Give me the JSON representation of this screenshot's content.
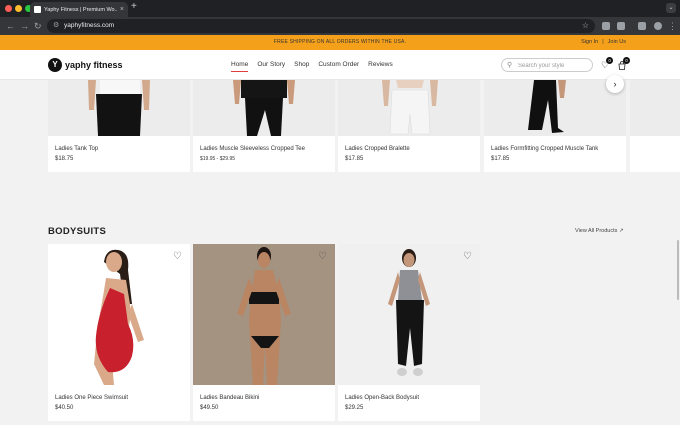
{
  "browser": {
    "tab_title": "Yaphy Fitness | Premium Wo...",
    "url": "yaphyfitness.com",
    "new_tab": "+",
    "tab_close": "×"
  },
  "promo": {
    "text": "FREE SHIPPING ON ALL ORDERS WITHIN THE USA.",
    "sign_in": "Sign In",
    "separator": "|",
    "join": "Join Us"
  },
  "header": {
    "logo_mark": "Y",
    "logo_text": "yaphy fitness",
    "nav": [
      "Home",
      "Our Story",
      "Shop",
      "Custom Order",
      "Reviews"
    ],
    "search_placeholder": "Search your style",
    "wishlist_count": "0",
    "cart_count": "0"
  },
  "top_row": [
    {
      "name": "Ladies Tank Top",
      "price": "$18.75"
    },
    {
      "name": "Ladies Muscle Sleeveless Cropped Tee",
      "price": "$19.95 - $29.95"
    },
    {
      "name": "Ladies Cropped Bralette",
      "price": "$17.85"
    },
    {
      "name": "Ladies Formfitting Cropped Muscle Tank",
      "price": "$17.85"
    }
  ],
  "bodysuits": {
    "title": "BODYSUITS",
    "view_all": "View All Products",
    "products": [
      {
        "name": "Ladies One Piece Swimsuit",
        "price": "$40.50"
      },
      {
        "name": "Ladies Bandeau Bikini",
        "price": "$49.50"
      },
      {
        "name": "Ladies Open-Back Bodysuit",
        "price": "$29.25"
      }
    ]
  },
  "colors": {
    "promo_bar": "#f5a01a",
    "active_nav_underline": "#e23b3b",
    "browser_dark": "#202124"
  },
  "icons": [
    "search-icon",
    "heart-icon",
    "cart-icon",
    "chevron-right-icon",
    "arrow-up-right-icon"
  ]
}
